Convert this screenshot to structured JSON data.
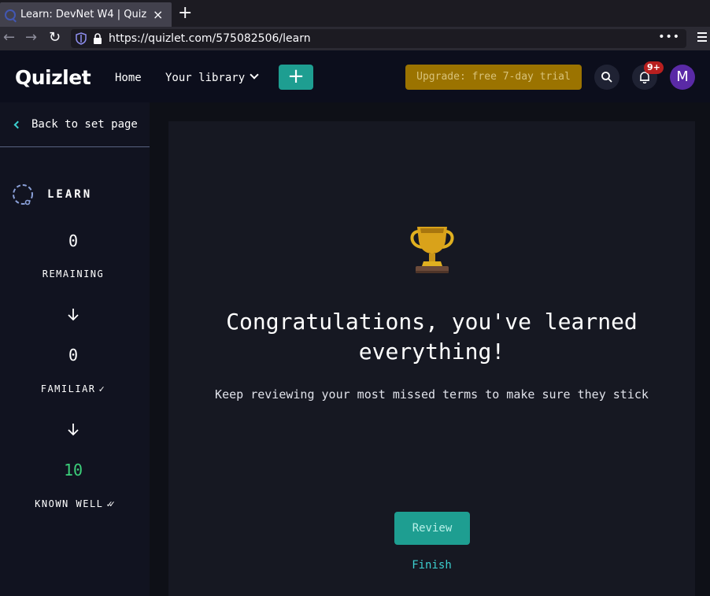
{
  "browser": {
    "tab_title": "Learn: DevNet W4 | Quizlet",
    "tab_close": "×",
    "new_tab": "+",
    "url": "https://quizlet.com/575082506/learn",
    "url_more": "•••",
    "back": "←",
    "forward": "→",
    "reload": "↻"
  },
  "header": {
    "logo": "Quizlet",
    "home": "Home",
    "library": "Your library",
    "add": "+",
    "upgrade": "Upgrade: free 7-day trial",
    "notifications_badge": "9+",
    "avatar_initial": "M"
  },
  "sidebar": {
    "back_label": "Back to set page",
    "mode": "LEARN",
    "remaining_count": "0",
    "remaining_label": "REMAINING",
    "familiar_count": "0",
    "familiar_label": "FAMILIAR",
    "familiar_check": "✓",
    "known_count": "10",
    "known_label": "KNOWN WELL",
    "known_check": "✓✓"
  },
  "main": {
    "title_line1": "Congratulations, you've learned",
    "title_line2": "everything!",
    "subtitle": "Keep reviewing your most missed terms to make sure they stick",
    "review_button": "Review",
    "finish_link": "Finish"
  },
  "colors": {
    "accent_teal": "#1e9e91",
    "known_green": "#3ccf7a",
    "upgrade_gold": "#9b7300",
    "avatar_purple": "#5a2aa6"
  }
}
